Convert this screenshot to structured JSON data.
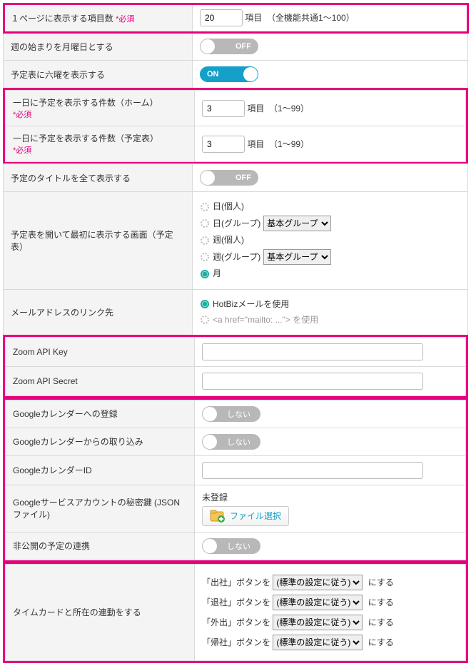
{
  "required_label": "*必須",
  "items_per_page": {
    "label": "１ページに表示する項目数",
    "value": "20",
    "unit": "項目",
    "range": "（全機能共通1～100）"
  },
  "week_monday": {
    "label": "週の始まりを月曜日とする",
    "state": "OFF"
  },
  "rokuyou": {
    "label": "予定表に六曜を表示する",
    "state": "ON"
  },
  "home_items": {
    "label": "一日に予定を表示する件数（ホーム）",
    "value": "3",
    "unit": "項目",
    "range": "（1～99）"
  },
  "schedule_items": {
    "label": "一日に予定を表示する件数（予定表）",
    "value": "3",
    "unit": "項目",
    "range": "（1～99）"
  },
  "title_all": {
    "label": "予定のタイトルを全て表示する",
    "state": "OFF"
  },
  "first_screen": {
    "label": "予定表を開いて最初に表示する画面（予定表）",
    "options": {
      "day_personal": "日(個人)",
      "day_group": "日(グループ)",
      "week_personal": "週(個人)",
      "week_group": "週(グループ)",
      "month": "月"
    },
    "group_select": "基本グループ"
  },
  "mail_link": {
    "label": "メールアドレスのリンク先",
    "opt1": "HotBizメールを使用",
    "opt2": "<a href=\"mailto: ...\"> を使用"
  },
  "zoom_key": {
    "label": "Zoom API Key"
  },
  "zoom_secret": {
    "label": "Zoom API Secret"
  },
  "gcal_register": {
    "label": "Googleカレンダーへの登録",
    "state": "しない"
  },
  "gcal_import": {
    "label": "Googleカレンダーからの取り込み",
    "state": "しない"
  },
  "gcal_id": {
    "label": "GoogleカレンダーID"
  },
  "gservice_key": {
    "label": "Googleサービスアカウントの秘密鍵 (JSONファイル)",
    "status": "未登録",
    "button": "ファイル選択"
  },
  "private_link": {
    "label": "非公開の予定の連携",
    "state": "しない"
  },
  "timecard": {
    "label": "タイムカードと所在の連動をする",
    "rows": [
      {
        "prefix": "「出社」ボタンを",
        "select": "(標準の設定に従う)",
        "suffix": "にする"
      },
      {
        "prefix": "「退社」ボタンを",
        "select": "(標準の設定に従う)",
        "suffix": "にする"
      },
      {
        "prefix": "「外出」ボタンを",
        "select": "(標準の設定に従う)",
        "suffix": "にする"
      },
      {
        "prefix": "「帰社」ボタンを",
        "select": "(標準の設定に従う)",
        "suffix": "にする"
      }
    ]
  }
}
